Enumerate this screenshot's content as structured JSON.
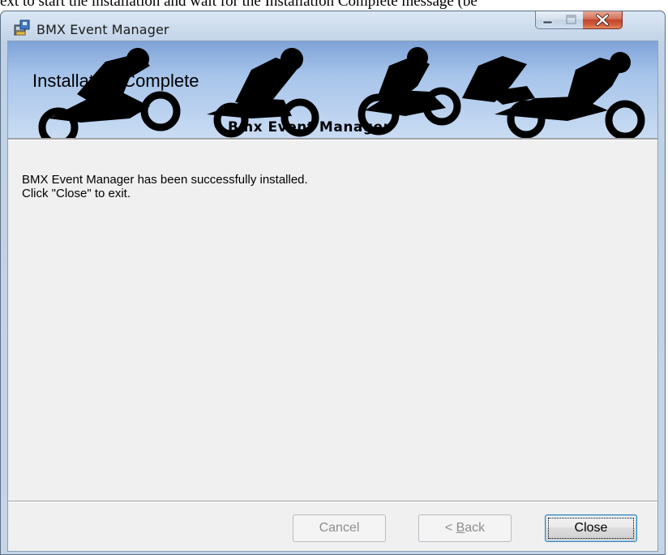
{
  "document": {
    "visible_line": "ext to start the installation and wait for the Installation Complete message (be"
  },
  "window": {
    "title": "BMX Event Manager",
    "icons": {
      "app": "installer-icon",
      "minimize": "minimize-icon",
      "maximize": "maximize-icon",
      "close": "close-x-icon"
    }
  },
  "banner": {
    "heading": "Installation Complete",
    "subtitle": "Bmx Event Manager",
    "art": "bmx-riders-silhouette"
  },
  "message": {
    "line1": "BMX Event Manager has been successfully installed.",
    "line2": "Click \"Close\" to exit."
  },
  "buttons": {
    "cancel": "Cancel",
    "back_prefix": "< ",
    "back_accel": "B",
    "back_rest": "ack",
    "close": "Close"
  },
  "colors": {
    "close_caption": "#c2432a",
    "banner_top": "#7fa3d8",
    "dialog_bg": "#f0f0f0"
  }
}
